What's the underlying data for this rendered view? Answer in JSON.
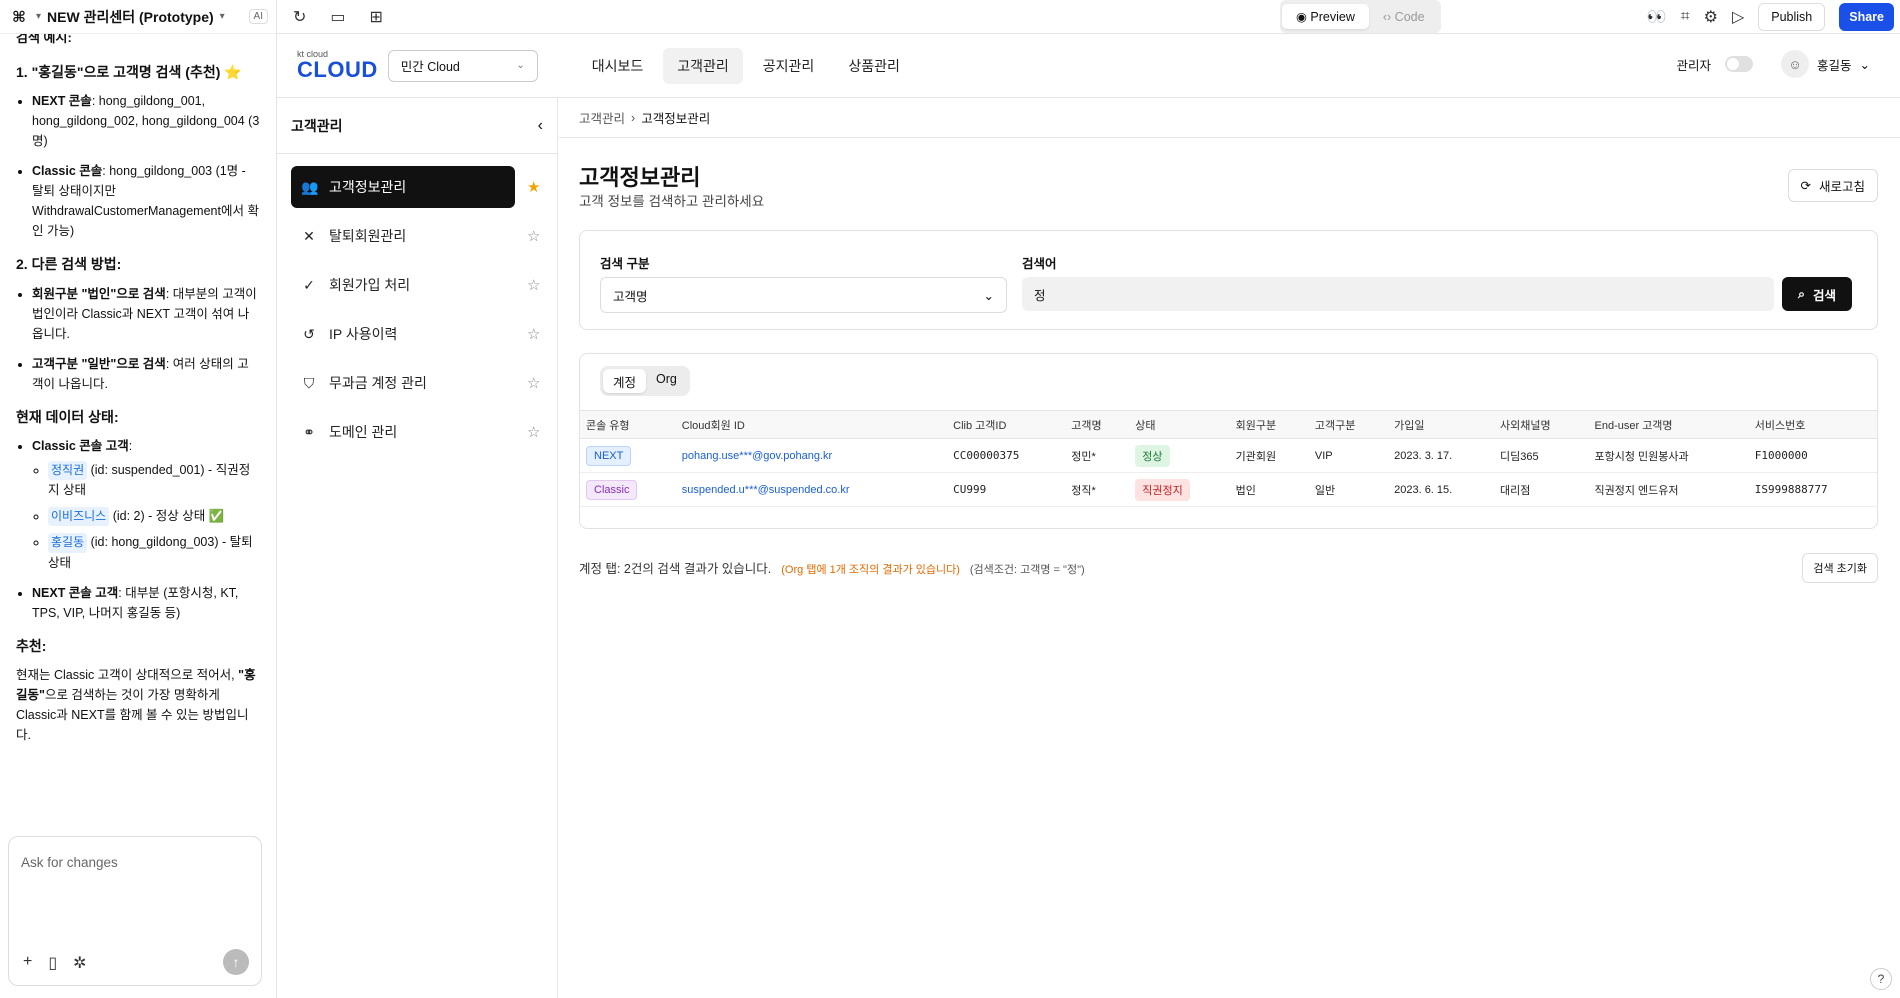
{
  "chat": {
    "project_title": "NEW 관리센터 (Prototype)",
    "ai_badge": "AI",
    "top_cut": "검색 예시:",
    "h1": "1. \"홍길동\"으로 고객명 검색 (추천) ⭐",
    "l1_b": "NEXT 콘솔",
    "l1_t": ": hong_gildong_001, hong_gildong_002, hong_gildong_004 (3명)",
    "l2_b": "Classic 콘솔",
    "l2_t": ": hong_gildong_003 (1명 - 탈퇴 상태이지만 WithdrawalCustomerManagement에서 확인 가능)",
    "h2": "2. 다른 검색 방법:",
    "l3_b": "회원구분 \"법인\"으로 검색",
    "l3_t": ": 대부분의 고객이 법인이라 Classic과 NEXT 고객이 섞여 나옵니다.",
    "l4_b": "고객구분 \"일반\"으로 검색",
    "l4_t": ": 여러 상태의 고객이 나옵니다.",
    "h3": "현재 데이터 상태:",
    "l5_b": "Classic 콘솔 고객",
    "l5_t": ":",
    "s1_tag": "정직권",
    "s1_t": "(id: suspended_001) - 직권정지 상태",
    "s2_tag": "이비즈니스",
    "s2_t": "(id: 2) - 정상 상태 ✅",
    "s3_tag": "홍길동",
    "s3_t": "(id: hong_gildong_003) - 탈퇴 상태",
    "l6_b": "NEXT 콘솔 고객",
    "l6_t": ": 대부분 (포항시청, KT, TPS, VIP, 나머지 홍길동 등)",
    "h4": "추천:",
    "p1": "현재는 Classic 고객이 상대적으로 적어서,",
    "p1_b": "\"홍길동\"",
    "p1_t": "으로 검색하는 것이 가장 명확하게 Classic과 NEXT를 함께 볼 수 있는 방법입니다.",
    "input_placeholder": "Ask for changes"
  },
  "toolbar": {
    "preview": "Preview",
    "code": "Code",
    "publish": "Publish",
    "share": "Share"
  },
  "header": {
    "brand_small": "kt cloud",
    "brand_big": "CLOUD",
    "cloud_select": "민간 Cloud",
    "nav": [
      "대시보드",
      "고객관리",
      "공지관리",
      "상품관리"
    ],
    "admin_label": "관리자",
    "user_name": "홍길동"
  },
  "side": {
    "title": "고객관리",
    "items": [
      "고객정보관리",
      "탈퇴회원관리",
      "회원가입 처리",
      "IP 사용이력",
      "무과금 계정 관리",
      "도메인 관리"
    ]
  },
  "main": {
    "crumb_parent": "고객관리",
    "crumb_current": "고객정보관리",
    "title": "고객정보관리",
    "subtitle": "고객 정보를 검색하고 관리하세요",
    "refresh": "새로고침",
    "search_type_label": "검색 구분",
    "search_type_value": "고객명",
    "keyword_label": "검색어",
    "keyword_value": "정",
    "search_button": "검색",
    "tabs": [
      "계정",
      "Org"
    ],
    "columns": [
      "콘솔 유형",
      "Cloud회원 ID",
      "Clib 고객ID",
      "고객명",
      "상태",
      "회원구분",
      "고객구분",
      "가입일",
      "사외채널명",
      "End-user 고객명",
      "서비스번호"
    ],
    "rows": [
      [
        "NEXT",
        "pohang.use***@gov.pohang.kr",
        "CC00000375",
        "정민*",
        "정상",
        "기관회원",
        "VIP",
        "2023. 3. 17.",
        "디딤365",
        "포항시청 민원봉사과",
        "F1000000"
      ],
      [
        "Classic",
        "suspended.u***@suspended.co.kr",
        "CU999",
        "정직*",
        "직권정지",
        "법인",
        "일반",
        "2023. 6. 15.",
        "대리점",
        "직권정지 엔드유저",
        "IS999888777"
      ]
    ],
    "result_text": "계정 탭: 2건의 검색 결과가 있습니다.",
    "result_org": "(Org 탭에 1개 조직의 결과가 있습니다)",
    "result_cond": "(검색조건: 고객명 = \"정\")",
    "reset": "검색 초기화"
  },
  "colors": {
    "accent": "#1a4fe8",
    "brand": "#1a4fd8"
  }
}
